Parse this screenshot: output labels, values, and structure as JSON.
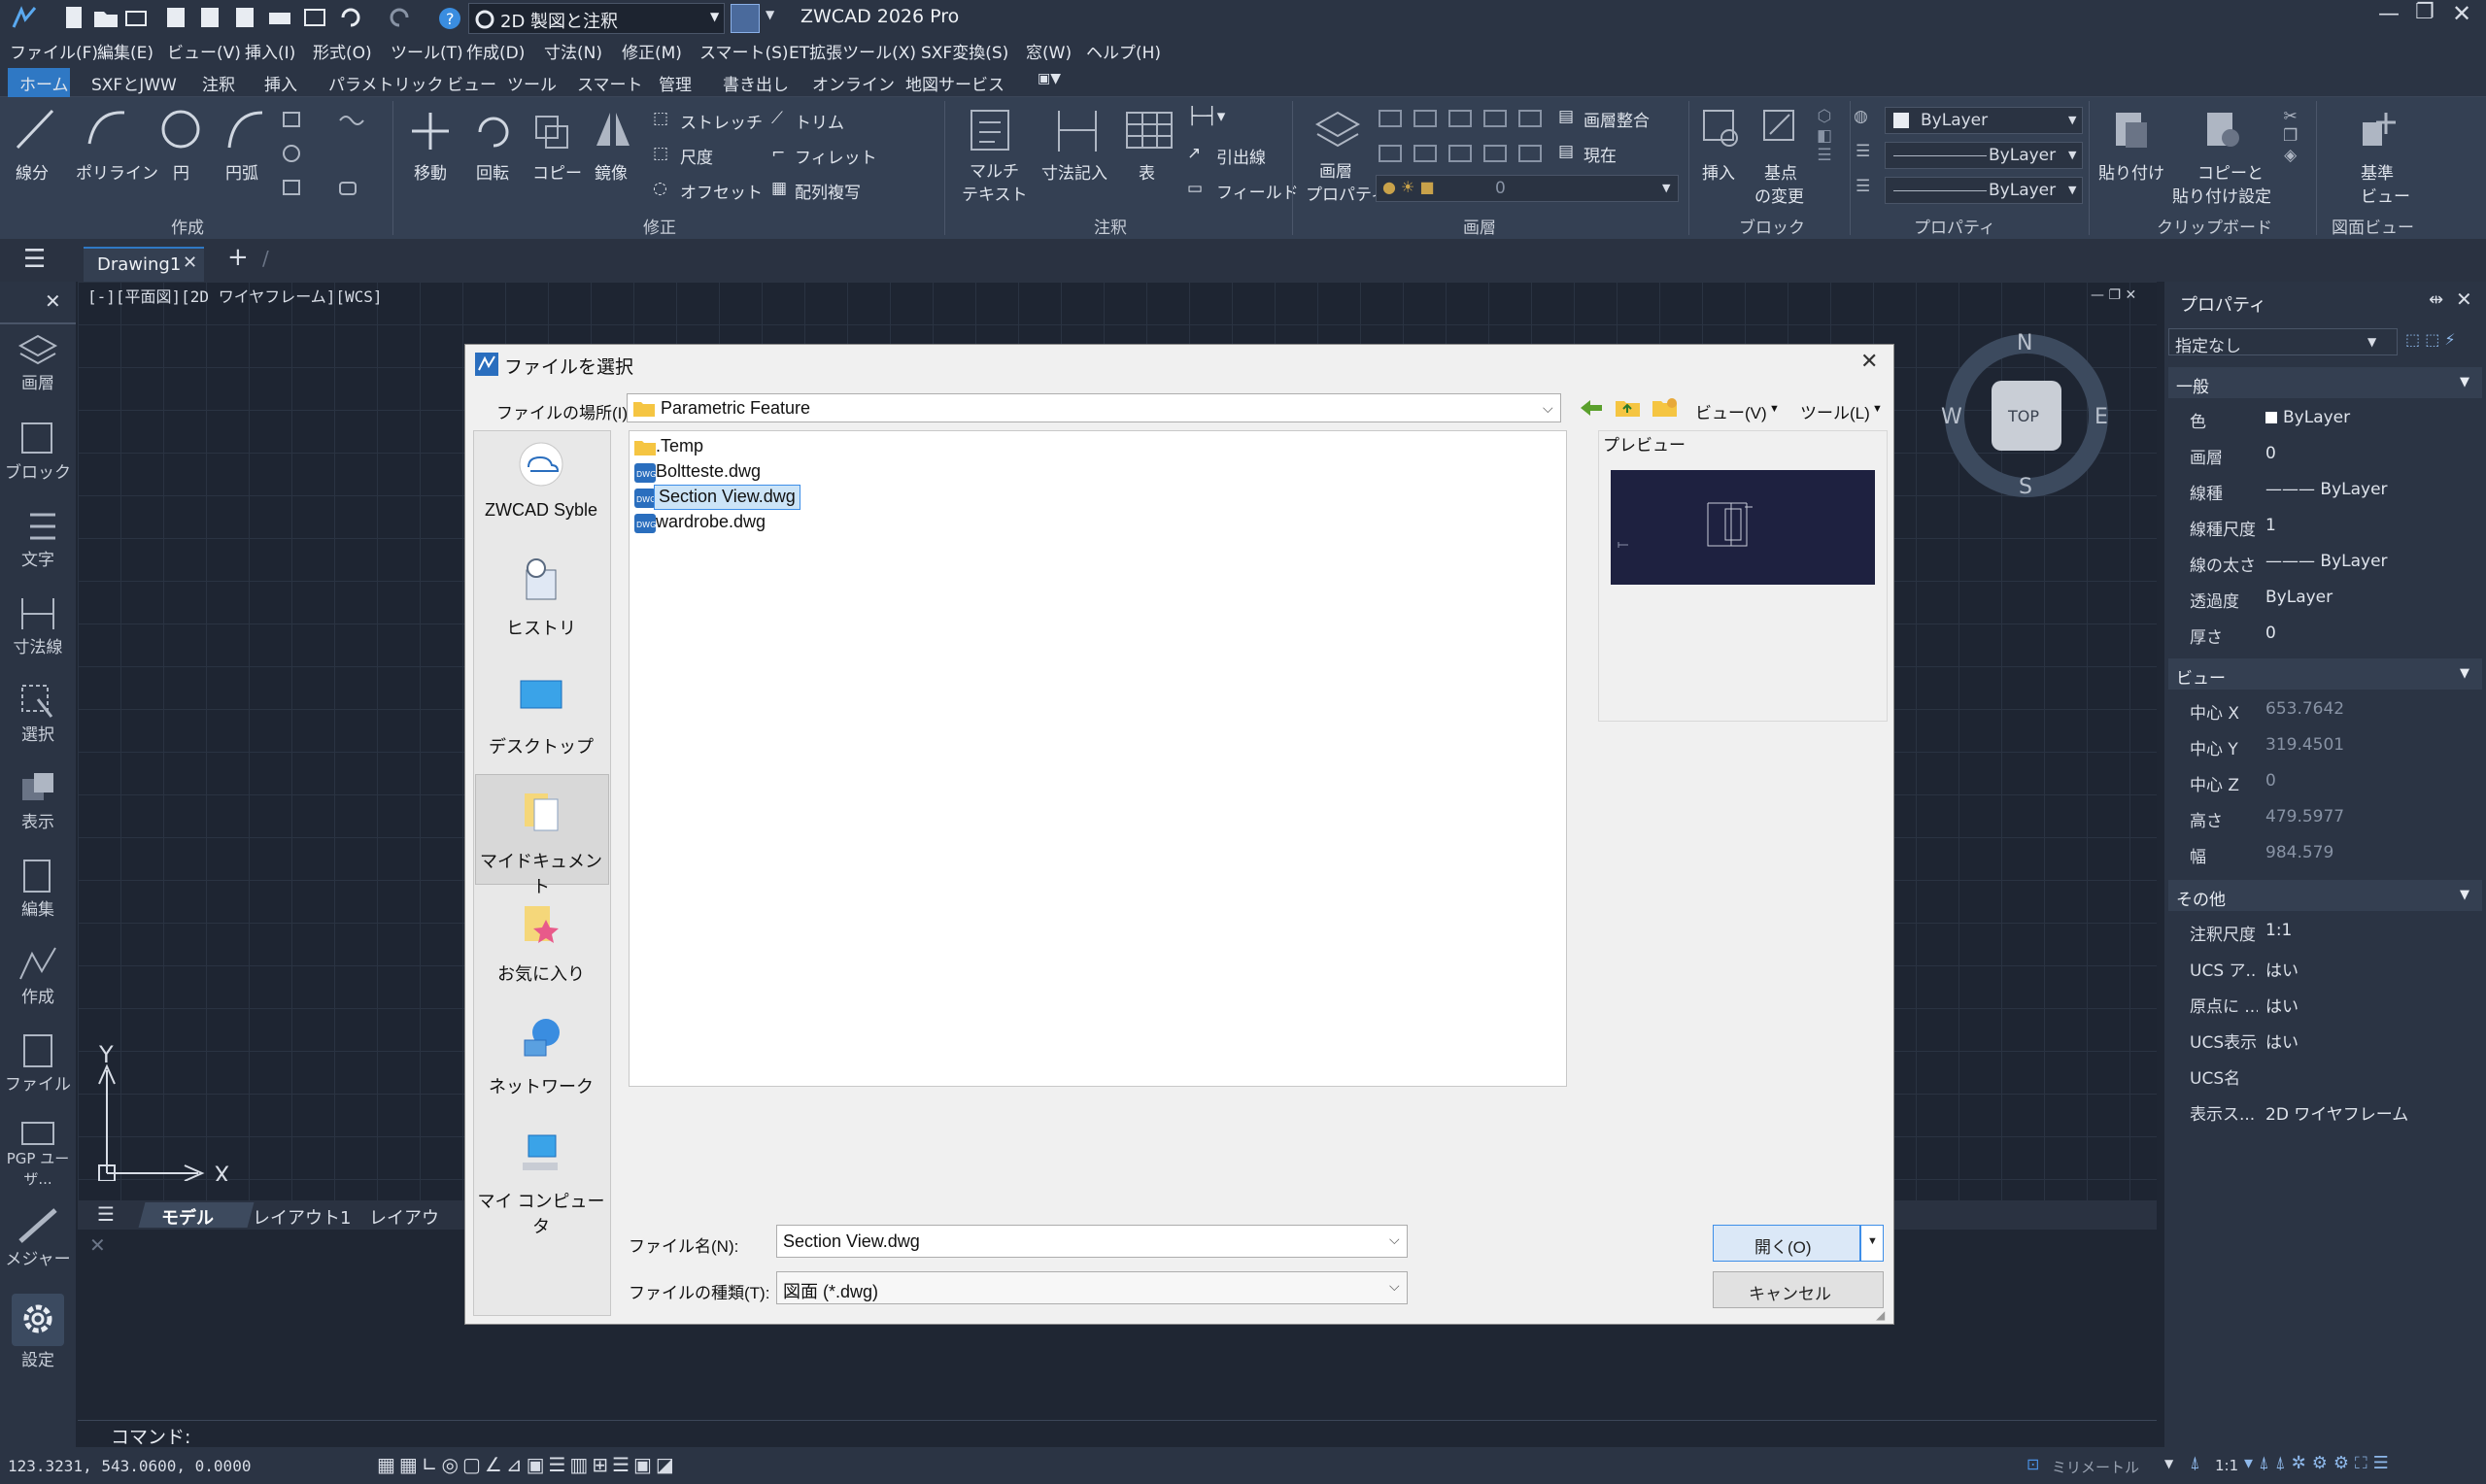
{
  "app": {
    "title": "ZWCAD 2026 Pro",
    "workspace": "2D 製図と注釈",
    "window_controls": [
      "minimize-icon",
      "restore-icon",
      "close-icon"
    ]
  },
  "menus": [
    "ファイル(F)",
    "編集(E)",
    "ビュー(V)",
    "挿入(I)",
    "形式(O)",
    "ツール(T)",
    "作成(D)",
    "寸法(N)",
    "修正(M)",
    "スマート(S)",
    "ET拡張ツール(X)",
    "SXF変換(S)",
    "窓(W)",
    "ヘルプ(H)"
  ],
  "ribbon_tabs": [
    "ホーム",
    "SXFとJWW",
    "注釈",
    "挿入",
    "パラメトリック",
    "ビュー",
    "ツール",
    "スマート",
    "管理",
    "書き出し",
    "オンライン",
    "地図サービス"
  ],
  "ribbon": {
    "draw": {
      "line": "線分",
      "polyline": "ポリライン",
      "circle": "円",
      "arc": "円弧",
      "group": "作成"
    },
    "modify": {
      "move": "移動",
      "rotate": "回転",
      "copy": "コピー",
      "mirror": "鏡像",
      "stretch": "ストレッチ",
      "scale": "尺度",
      "offset": "オフセット",
      "trim": "トリム",
      "fillet": "フィレット",
      "array": "配列複写",
      "group": "修正"
    },
    "annotation": {
      "mtext_1": "マルチ",
      "mtext_2": "テキスト",
      "dim": "寸法記入",
      "table": "表",
      "leader": "引出線",
      "field": "フィールド",
      "group": "注釈"
    },
    "layers": {
      "prop_1": "画層",
      "prop_2": "プロパティ",
      "merge": "画層整合",
      "current": "現在",
      "layer_value": "0",
      "group": "画層"
    },
    "block": {
      "insert": "挿入",
      "base_1": "基点",
      "base_2": "の変更",
      "group": "ブロック"
    },
    "properties": {
      "color": "ByLayer",
      "linetype": "ByLayer",
      "lineweight": "ByLayer",
      "group": "プロパティ"
    },
    "clipboard": {
      "paste": "貼り付け",
      "copy_base_1": "コピーと",
      "copy_base_2": "貼り付け設定",
      "group": "クリップボード"
    },
    "view": {
      "base_1": "基準",
      "base_2": "ビュー",
      "group": "図面ビュー"
    }
  },
  "doc_tabs": {
    "active": "Drawing1"
  },
  "viewport": {
    "label": "[-][平面図][2D ワイヤフレーム][WCS]"
  },
  "viewcube": {
    "top": "TOP",
    "n": "N",
    "s": "S",
    "e": "E",
    "w": "W"
  },
  "ucs": {
    "x": "X",
    "y": "Y"
  },
  "left_toolbar": [
    "画層",
    "ブロック",
    "文字",
    "寸法線",
    "選択",
    "表示",
    "編集",
    "作成",
    "ファイル",
    "PGP ユーザ...",
    "メジャー",
    "設定"
  ],
  "layout_tabs": [
    "モデル",
    "レイアウト1",
    "レイアウ"
  ],
  "command": {
    "prompt": "コマンド:"
  },
  "status": {
    "coords": "123.3231,  543.0600,  0.0000",
    "units": "ミリメートル",
    "scale": "1:1"
  },
  "properties_panel": {
    "title": "プロパティ",
    "selection": "指定なし",
    "general": {
      "title": "一般",
      "rows": [
        [
          "色",
          "ByLayer"
        ],
        [
          "画層",
          "0"
        ],
        [
          "線種",
          "——— ByLayer"
        ],
        [
          "線種尺度",
          "1"
        ],
        [
          "線の太さ",
          "——— ByLayer"
        ],
        [
          "透過度",
          "ByLayer"
        ],
        [
          "厚さ",
          "0"
        ]
      ]
    },
    "view": {
      "title": "ビュー",
      "rows": [
        [
          "中心 X",
          "653.7642"
        ],
        [
          "中心 Y",
          "319.4501"
        ],
        [
          "中心 Z",
          "0"
        ],
        [
          "高さ",
          "479.5977"
        ],
        [
          "幅",
          "984.579"
        ]
      ]
    },
    "misc": {
      "title": "その他",
      "rows": [
        [
          "注釈尺度",
          "1:1"
        ],
        [
          "UCS ア...",
          "はい"
        ],
        [
          "原点に ...",
          "はい"
        ],
        [
          "UCS表示",
          "はい"
        ],
        [
          "UCS名",
          ""
        ],
        [
          "表示ス...",
          "2D ワイヤフレーム"
        ]
      ]
    }
  },
  "dialog": {
    "title": "ファイルを選択",
    "location_label": "ファイルの場所(I):",
    "location_value": "Parametric Feature",
    "view_menu": "ビュー(V)",
    "tools_menu": "ツール(L)",
    "preview_label": "プレビュー",
    "places": [
      "ZWCAD Syble",
      "ヒストリ",
      "デスクトップ",
      "マイドキュメント",
      "お気に入り",
      "ネットワーク",
      "マイ コンピュータ"
    ],
    "files": [
      ".Temp",
      "Boltteste.dwg",
      "Section View.dwg",
      "wardrobe.dwg"
    ],
    "selected_file": "Section View.dwg",
    "filename_label": "ファイル名(N):",
    "filename_value": "Section View.dwg",
    "filetype_label": "ファイルの種類(T):",
    "filetype_value": "図面 (*.dwg)",
    "open_button": "開く(O)",
    "cancel_button": "キャンセル"
  },
  "colors": {
    "accent": "#0078d7",
    "selection": "#cce4f7",
    "preview_bg": "#1e2140"
  }
}
